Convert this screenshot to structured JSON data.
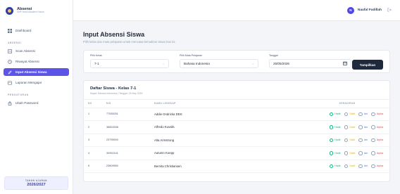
{
  "brand": {
    "name": "Absensi",
    "subtitle": "SMP Insan Akademi Harum"
  },
  "sidebar": {
    "items": [
      {
        "label": "Dashboard",
        "icon": "grid-icon"
      },
      {
        "section": "ABSENSI"
      },
      {
        "label": "Scan Absensi",
        "icon": "scan-icon"
      },
      {
        "label": "Riwayat Absensi",
        "icon": "history-icon"
      },
      {
        "label": "Input Absensi Siswa",
        "icon": "edit-icon",
        "active": true
      },
      {
        "label": "Laporan Mengajar",
        "icon": "report-icon"
      },
      {
        "section": "PENGATURAN"
      },
      {
        "label": "Ubah Password",
        "icon": "lock-icon"
      }
    ],
    "year_label": "TAHUN AJARAN",
    "year_value": "2026/2027"
  },
  "topbar": {
    "avatar_initial": "N",
    "user_name": "Naufal Fadillah"
  },
  "page": {
    "title": "Input Absensi Siswa",
    "subtitle": "Pilih kelas dan mata pelajaran untuk mencatat kehadiran siswa hari ini."
  },
  "filters": {
    "kelas_label": "Pilih Kelas",
    "kelas_value": "7-1",
    "mapel_label": "Pilih Mata Pelajaran",
    "mapel_value": "Bahasa Indonesia",
    "tanggal_label": "Tanggal",
    "tanggal_value": "26/05/2026",
    "button": "Tampilkan"
  },
  "list": {
    "title": "Daftar Siswa - Kelas 7-1",
    "subtitle": "Mapel: Bahasa Indonesia | Tanggal: 26 May 2026",
    "columns": {
      "no": "NO",
      "nis": "NIS",
      "nama": "NAMA LENGKAP",
      "kehadiran": "KEHADIRAN"
    },
    "status_labels": {
      "hadir": "Hadir",
      "sakit": "Sakit",
      "izin": "Izin",
      "alpha": "Alpha"
    },
    "rows": [
      {
        "no": "1",
        "nis": "77535251",
        "nama": "Addie Ondricka DDS",
        "status": "hadir"
      },
      {
        "no": "2",
        "nis": "38653338",
        "nama": "Alfredo Kuvalis",
        "status": "hadir"
      },
      {
        "no": "3",
        "nis": "23795900",
        "nama": "Alta Armstrong",
        "status": "hadir"
      },
      {
        "no": "4",
        "nis": "30952141",
        "nama": "Autumn Koepp",
        "status": "hadir"
      },
      {
        "no": "5",
        "nis": "23809950",
        "nama": "Bernita Christiansen",
        "status": "hadir"
      }
    ]
  },
  "colors": {
    "accent": "#5b54e6",
    "dark_button": "#1e293b",
    "hadir": "#10b981",
    "sakit": "#eab308",
    "izin": "#3b82f6",
    "alpha": "#ef4444"
  }
}
